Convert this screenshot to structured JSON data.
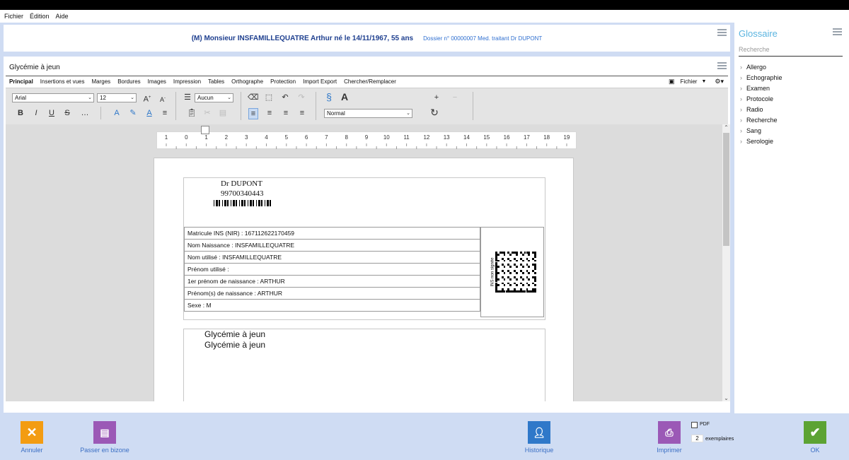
{
  "menu": {
    "items": [
      "Fichier",
      "Édition",
      "Aide"
    ]
  },
  "header": {
    "patient": "(M) Monsieur INSFAMILLEQUATRE Arthur né le 14/11/1967, 55 ans",
    "dossier": "Dossier n° 00000007 Med. traitant Dr DUPONT"
  },
  "editor": {
    "doc_title": "Glycémie à jeun",
    "tabs": [
      "Principal",
      "Insertions et vues",
      "Marges",
      "Bordures",
      "Images",
      "Impression",
      "Tables",
      "Orthographe",
      "Protection",
      "Import Export",
      "Chercher/Remplacer"
    ],
    "fichier_label": "Fichier",
    "font": "Arial",
    "size": "12",
    "list_style": "Aucun",
    "paragraph_style": "Normal",
    "ruler_numbers": [
      "1",
      "0",
      "1",
      "2",
      "3",
      "4",
      "5",
      "6",
      "7",
      "8",
      "9",
      "10",
      "11",
      "12",
      "13",
      "14",
      "15",
      "16",
      "17",
      "18",
      "19"
    ]
  },
  "document": {
    "doctor": "Dr DUPONT",
    "rpps": "99700340443",
    "ins_rows": [
      "Matricule INS (NIR) : 167112622170459",
      "Nom Naissance : INSFAMILLEQUATRE",
      "Nom utilisé : INSFAMILLEQUATRE",
      "Prénom utilisé :",
      "1er prénom de naissance : ARTHUR",
      "Prénom(s) de naissance : ARTHUR",
      "Sexe : M"
    ],
    "ins_note": "INS non signée",
    "body_lines": [
      "Glycémie à jeun",
      "Glycémie à jeun"
    ]
  },
  "glossary": {
    "title": "Glossaire",
    "search_placeholder": "Recherche",
    "items": [
      "Allergo",
      "Echographie",
      "Examen",
      "Protocole",
      "Radio",
      "Recherche",
      "Sang",
      "Serologie"
    ]
  },
  "footer": {
    "cancel": "Annuler",
    "bizone": "Passer en bizone",
    "history": "Historique",
    "print": "Imprimer",
    "pdf": "PDF",
    "copies": "2",
    "copies_label": "exemplaires",
    "ok": "OK"
  },
  "colors": {
    "cancel": "#f39c12",
    "bizone": "#9b59b6",
    "history": "#2f78c9",
    "print": "#9b59b6",
    "ok": "#5ca333"
  }
}
